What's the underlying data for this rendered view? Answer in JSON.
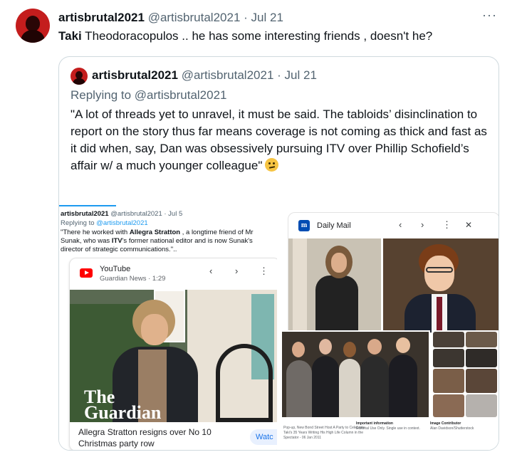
{
  "tweet": {
    "author_name": "artisbrutal2021",
    "author_handle": "@artisbrutal2021",
    "separator": "·",
    "date": "Jul 21",
    "more_label": "···",
    "text_bold": "Taki",
    "text_rest": " Theodoracopulos .. he has some interesting friends , doesn't he?"
  },
  "quoted": {
    "author_name": "artisbrutal2021",
    "author_handle": "@artisbrutal2021",
    "separator": "·",
    "date": "Jul 21",
    "replying_prefix": "Replying to ",
    "replying_handle": "@artisbrutal2021",
    "text": "\"A lot of threads yet to unravel, it must be said. The tabloids’ disinclination to report on the story thus far means coverage is not coming as thick and fast as it did when, say, Dan was obsessively pursuing ITV over Phillip Schofield’s affair w/ a much younger colleague\"",
    "emoji": "thinking-face-emoji"
  },
  "media_left": {
    "author_name": "artisbrutal2021",
    "author_meta": " @artisbrutal2021 · Jul 5",
    "replying_prefix": "Replying to ",
    "replying_handle": "@artisbrutal2021",
    "text_1": "\"There he worked with ",
    "text_bold_1": "Allegra Stratton",
    "text_2": " , a longtime friend of Mr Sunak, who was ",
    "text_bold_2": "ITV",
    "text_3": "'s former national editor and is now Sunak's director of strategic communications.\"..",
    "card": {
      "app": "YouTube",
      "source": "Guardian News · 1:29",
      "prev": "‹",
      "next": "›",
      "menu": "⋮",
      "logo_line1": "The",
      "logo_line2": "Guardian",
      "caption": "Allegra Stratton resigns over No 10 Christmas party row",
      "watch": "Watc"
    }
  },
  "media_right": {
    "card": {
      "app": "Daily Mail",
      "logo_letter": "m",
      "prev": "‹",
      "next": "›",
      "menu": "⋮",
      "close": "✕"
    },
    "caption_left_1": "Pop-up, New Bond Street Host A Party to Celebrate",
    "caption_left_2": "Taki's 35 Years Writing His High Life Column in the",
    "caption_left_3": "Spectator - 06 Jan 2011",
    "caption_mid_title": "Important information",
    "caption_mid_1": "Editorial Use Only. Single use in context.",
    "caption_right_title": "Image Contributor",
    "caption_right_1": "Alan Davidson/Shutterstock"
  },
  "colors": {
    "link_blue": "#1d9bf0",
    "muted_gray": "#536471",
    "border": "#cfd9de",
    "avatar_red": "#c41d1d"
  }
}
